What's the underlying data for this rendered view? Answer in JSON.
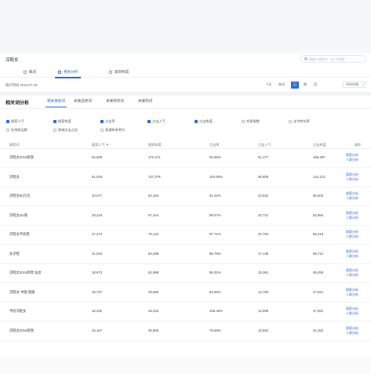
{
  "page": {
    "title": "凉鞋女"
  },
  "search": {
    "placeholder": "请输入搜索词 · 近7天搜索"
  },
  "tabs": [
    {
      "label": "概况",
      "icon": "overview-icon",
      "active": false
    },
    {
      "label": "相关分析",
      "icon": "related-analysis-icon",
      "active": true
    },
    {
      "label": "类目构成",
      "icon": "category-icon",
      "active": false
    }
  ],
  "stat": {
    "date": "统计时间 2019-07-29",
    "ranges": [
      "7天",
      "30天",
      "日",
      "周",
      "月"
    ],
    "active_range": "日",
    "select_value": "所有终端"
  },
  "section": {
    "title": "相关词分析",
    "subtabs": [
      {
        "label": "相关搜索词",
        "active": true
      },
      {
        "label": "关联品牌词",
        "active": false
      },
      {
        "label": "关联修饰词",
        "active": false
      },
      {
        "label": "关联热词",
        "active": false
      }
    ]
  },
  "filters": [
    {
      "label": "搜索人气",
      "checked": true
    },
    {
      "label": "搜索热度",
      "checked": true
    },
    {
      "label": "点击率",
      "checked": true
    },
    {
      "label": "点击人气",
      "checked": true
    },
    {
      "label": "点击热度",
      "checked": true
    },
    {
      "label": "交易指数",
      "checked": false
    },
    {
      "label": "支付转化率",
      "checked": false
    },
    {
      "label": "在线商品数",
      "checked": false
    },
    {
      "label": "商城点击占比",
      "checked": false
    },
    {
      "label": "直通车参考价",
      "checked": false
    }
  ],
  "table": {
    "headers": [
      "搜索词",
      "搜索人气 ▼",
      "搜索热度",
      "点击率",
      "点击人气",
      "点击热度",
      "操作"
    ],
    "op_labels": [
      "搜索分析",
      "人群分析"
    ],
    "rows": [
      [
        "凉鞋女2019新款",
        "54,509",
        "172,471",
        "92.66%",
        "51,177",
        "165,497"
      ],
      [
        "凉鞋女",
        "51,019",
        "137,479",
        "104.90%",
        "35,805",
        "141,213"
      ],
      [
        "凉鞋女50元内",
        "33,077",
        "84,163",
        "61.42%",
        "23,532",
        "80,003"
      ],
      [
        "凉鞋女ins潮",
        "28,219",
        "67,444",
        "89.57%",
        "20,731",
        "62,984"
      ],
      [
        "凉鞋女平底鞋",
        "27,273",
        "70,132",
        "97.71%",
        "20,794",
        "69,219"
      ],
      [
        "女凉鞋",
        "21,044",
        "60,298",
        "88.79%",
        "17,139",
        "58,712"
      ],
      [
        "凉鞋女2019新款 仙女",
        "18,973",
        "51,998",
        "86.32%",
        "15,361",
        "48,455"
      ],
      [
        "凉鞋女 中跟 粗跟",
        "15,727",
        "49,680",
        "83.65%",
        "14,793",
        "47,621"
      ],
      [
        "平底凉鞋女",
        "16,292",
        "48,232",
        "105.46%",
        "12,999",
        "47,651"
      ],
      [
        "凉鞋女2019新款",
        "15,167",
        "36,905",
        "75.69%",
        "10,852",
        "31,452"
      ]
    ]
  }
}
